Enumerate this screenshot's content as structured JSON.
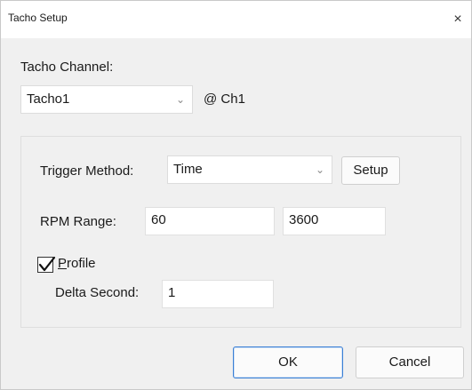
{
  "window": {
    "title": "Tacho Setup",
    "close_glyph": "×"
  },
  "tacho": {
    "channel_label": "Tacho Channel:",
    "channel_value": "Tacho1",
    "channel_suffix": "@ Ch1"
  },
  "trigger": {
    "method_label": "Trigger Method:",
    "method_value": "Time",
    "setup_button": "Setup"
  },
  "rpm": {
    "label": "RPM Range:",
    "min": "60",
    "separator": "~",
    "max": "3600"
  },
  "profile": {
    "label": "Profile",
    "checked": true,
    "delta_label": "Delta Second:",
    "delta_value": "1"
  },
  "buttons": {
    "ok": "OK",
    "cancel": "Cancel"
  },
  "icons": {
    "chevron": "chevron-down-icon",
    "check": "checkmark-icon",
    "close": "close-icon"
  }
}
